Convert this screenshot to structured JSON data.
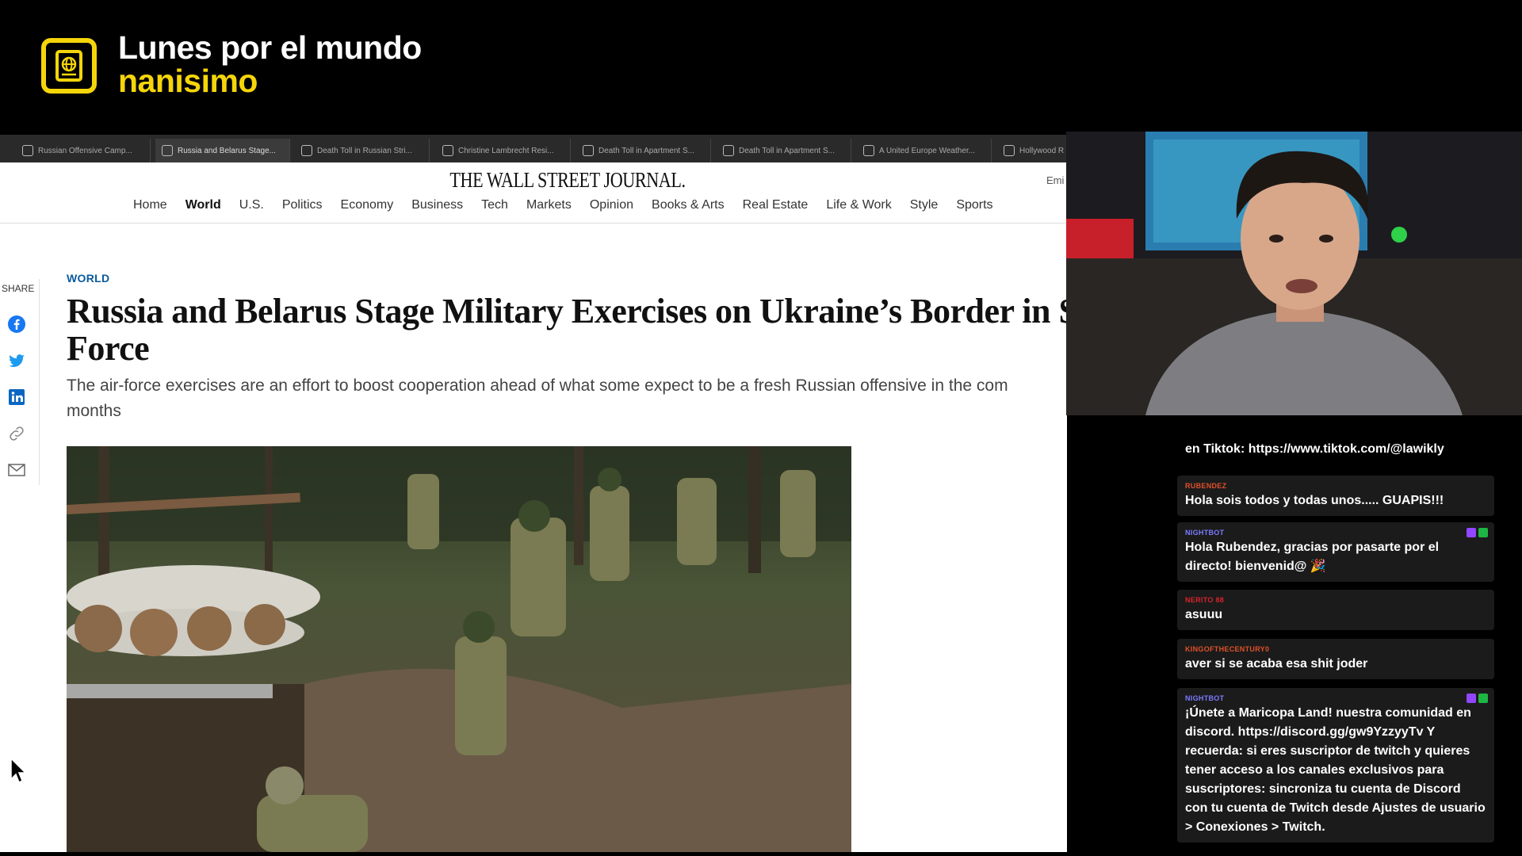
{
  "overlay": {
    "title": "Lunes por el mundo",
    "streamer": "nanisimo",
    "accent_color": "#f5d50a",
    "logo_icon": "globe-book-icon"
  },
  "browser": {
    "tabs": [
      {
        "label": "Russian Offensive Camp..."
      },
      {
        "label": "Russia and Belarus Stage..."
      },
      {
        "label": "Death Toll in Russian Stri..."
      },
      {
        "label": "Christine Lambrecht Resi..."
      },
      {
        "label": "Death Toll in Apartment S..."
      },
      {
        "label": "Death Toll in Apartment S..."
      },
      {
        "label": "A United Europe Weather..."
      },
      {
        "label": "Hollywood R"
      }
    ]
  },
  "wsj": {
    "logo": "THE WALL STREET JOURNAL.",
    "email_partial": "Emi",
    "nav": [
      "Home",
      "World",
      "U.S.",
      "Politics",
      "Economy",
      "Business",
      "Tech",
      "Markets",
      "Opinion",
      "Books & Arts",
      "Real Estate",
      "Life & Work",
      "Style",
      "Sports"
    ],
    "active_nav": "World"
  },
  "share": {
    "label": "SHARE",
    "icons": [
      "facebook-icon",
      "twitter-icon",
      "linkedin-icon",
      "link-icon",
      "email-icon"
    ]
  },
  "article": {
    "section": "WORLD",
    "headline_line1": "Russia and Belarus Stage Military Exercises on Ukraine’s Border in Sho",
    "headline_line2": "Force",
    "dek_line1": "The air-force exercises are an effort to boost cooperation ahead of what some expect to be a fresh Russian offensive in the com",
    "dek_line2": "months"
  },
  "chat": {
    "messages": [
      {
        "user": "",
        "user_color": "#ffffff",
        "text": "en Tiktok: https://www.tiktok.com/@lawikly"
      },
      {
        "user": "RUBENDEZ",
        "user_color": "#e0502a",
        "text": "Hola sois todos y todas unos..... GUAPIS!!!"
      },
      {
        "user": "NIGHTBOT",
        "user_color": "#7b7bff",
        "text": "Hola Rubendez, gracias por pasarte por el directo! bienvenid@ 🎉"
      },
      {
        "user": "NERITO 88",
        "user_color": "#d9232a",
        "text": "asuuu"
      },
      {
        "user": "KINGOFTHECENTURY0",
        "user_color": "#e0502a",
        "text": "aver si se acaba esa shit joder"
      },
      {
        "user": "NIGHTBOT",
        "user_color": "#7b7bff",
        "text": "¡Únete a Maricopa Land! nuestra comunidad en discord. https://discord.gg/gw9YzzyyTv Y recuerda: si eres suscriptor de twitch y quieres tener acceso a los canales exclusivos para suscriptores: sincroniza tu cuenta de Discord con tu cuenta de Twitch desde Ajustes de usuario > Conexiones > Twitch."
      }
    ]
  }
}
